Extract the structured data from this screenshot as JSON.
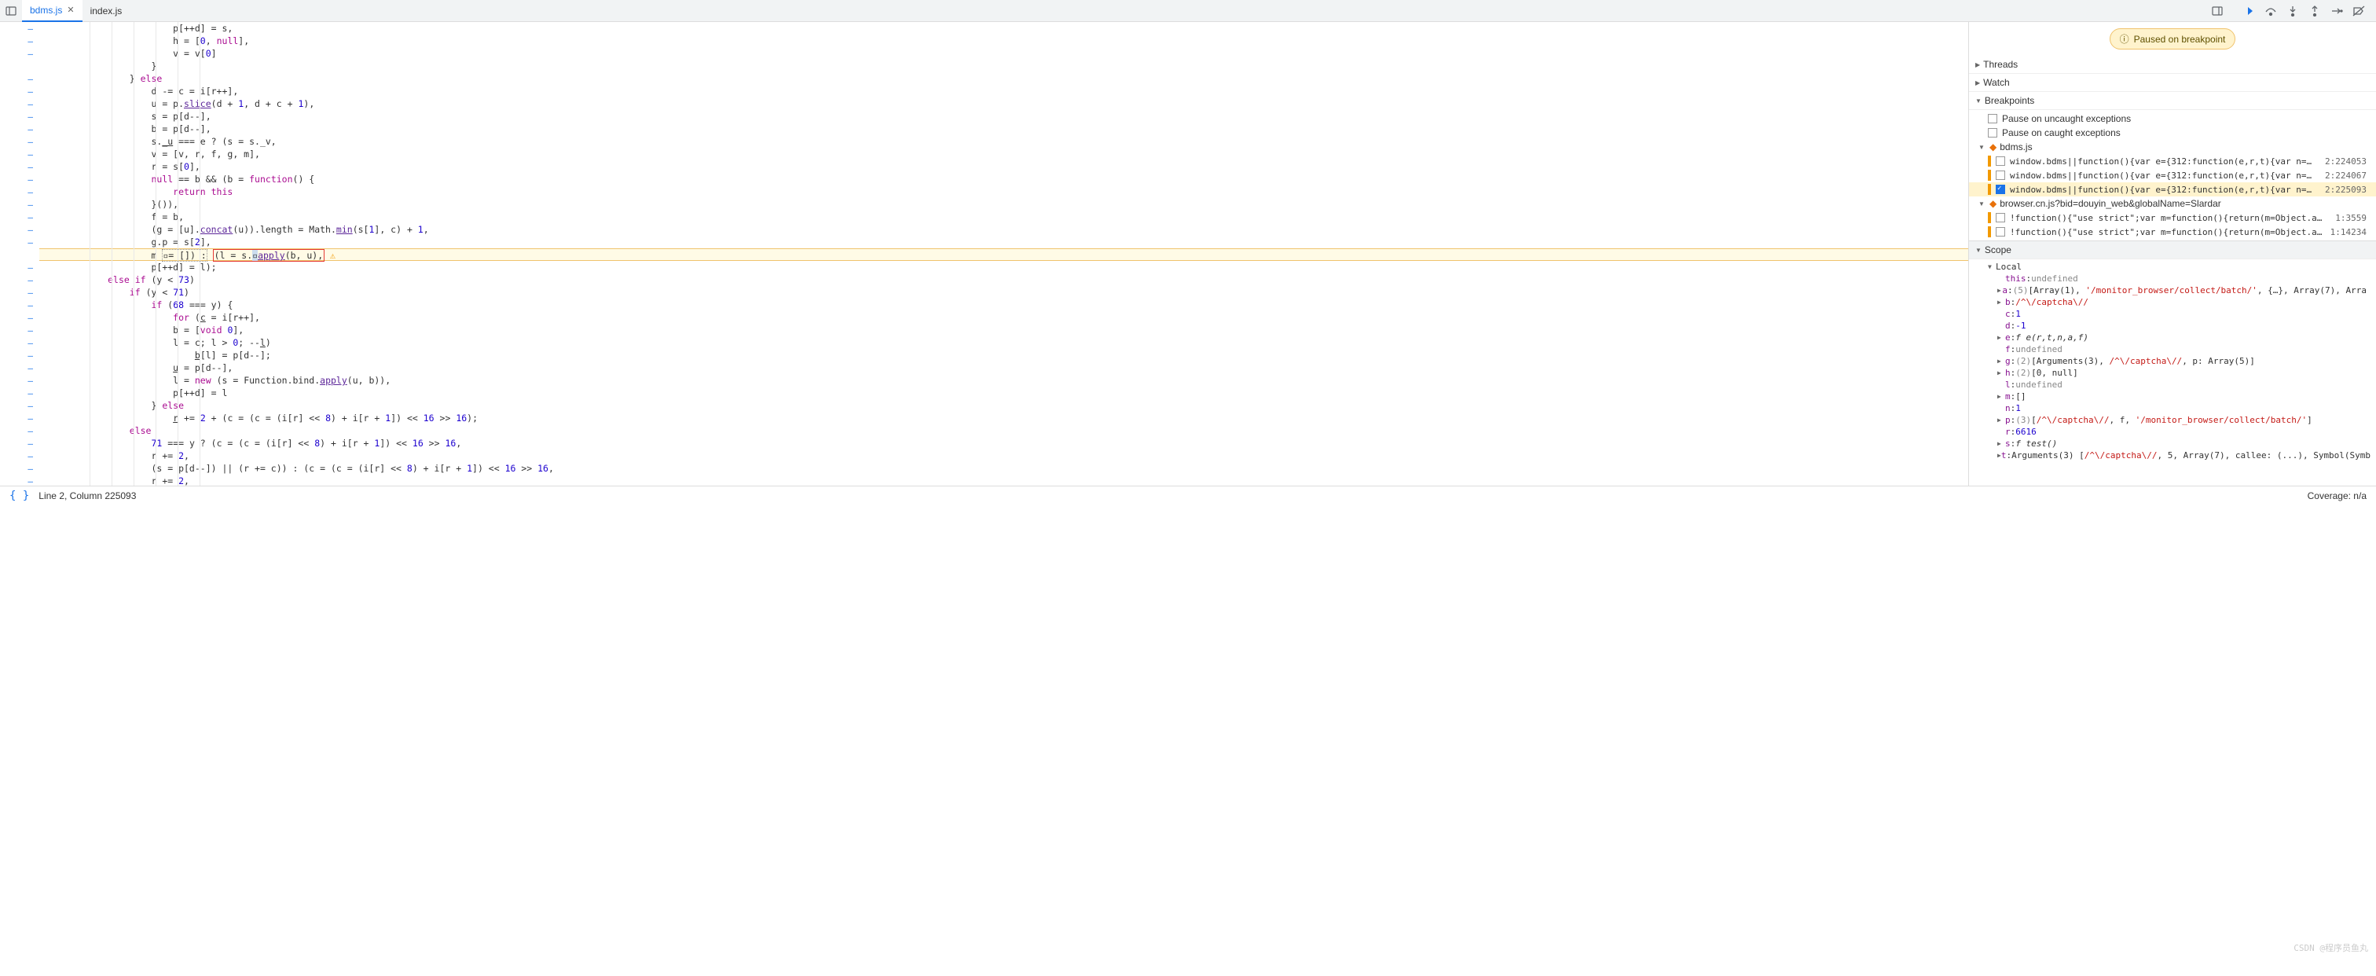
{
  "tabs": [
    {
      "name": "bdms.js",
      "active": true
    },
    {
      "name": "index.js",
      "active": false
    }
  ],
  "paused_text": "Paused on breakpoint",
  "panels": {
    "threads": "Threads",
    "watch": "Watch",
    "breakpoints": "Breakpoints",
    "scope": "Scope"
  },
  "bp_options": {
    "uncaught": "Pause on uncaught exceptions",
    "caught": "Pause on caught exceptions"
  },
  "bp_groups": [
    {
      "file": "bdms.js",
      "items": [
        {
          "text": "window.bdms||function(){var e={312:function(e,r,t){var n=…",
          "loc": "2:224053",
          "checked": false,
          "active": false
        },
        {
          "text": "window.bdms||function(){var e={312:function(e,r,t){var n=…",
          "loc": "2:224067",
          "checked": false,
          "active": false
        },
        {
          "text": "window.bdms||function(){var e={312:function(e,r,t){var n=…",
          "loc": "2:225093",
          "checked": true,
          "active": true
        }
      ]
    },
    {
      "file": "browser.cn.js?bid=douyin_web&globalName=Slardar",
      "items": [
        {
          "text": "!function(){\"use strict\";var m=function(){return(m=Object.a…",
          "loc": "1:3559",
          "checked": false,
          "active": false
        },
        {
          "text": "!function(){\"use strict\";var m=function(){return(m=Object.a…",
          "loc": "1:14234",
          "checked": false,
          "active": false
        }
      ]
    }
  ],
  "scope": {
    "local": "Local",
    "this_val": "undefined",
    "vars": [
      {
        "name": "a",
        "prefix": "(5)",
        "val": "[Array(1), '/monitor_browser/collect/batch/', {…}, Array(7), Arra",
        "expand": true
      },
      {
        "name": "b",
        "val": "/^\\/captcha\\//",
        "expand": true,
        "regex": true
      },
      {
        "name": "c",
        "val": "1",
        "num": true
      },
      {
        "name": "d",
        "val": "-1",
        "num": true
      },
      {
        "name": "e",
        "val": "f e(r,t,n,a,f)",
        "expand": true,
        "fn": true
      },
      {
        "name": "f",
        "val": "undefined",
        "undef": true
      },
      {
        "name": "g",
        "prefix": "(2)",
        "val": "[Arguments(3), /^\\/captcha\\//, p: Array(5)]",
        "expand": true
      },
      {
        "name": "h",
        "prefix": "(2)",
        "val": "[0, null]",
        "expand": true
      },
      {
        "name": "l",
        "val": "undefined",
        "undef": true
      },
      {
        "name": "m",
        "val": "[]",
        "expand": true
      },
      {
        "name": "n",
        "val": "1",
        "num": true
      },
      {
        "name": "p",
        "prefix": "(3)",
        "val": "[/^\\/captcha\\//, f, '/monitor_browser/collect/batch/']",
        "expand": true
      },
      {
        "name": "r",
        "val": "6616",
        "num": true
      },
      {
        "name": "s",
        "val": "f test()",
        "expand": true,
        "fn": true
      },
      {
        "name": "t",
        "val": "Arguments(3) [/^\\/captcha\\//, 5, Array(7), callee: (...), Symbol(Symb",
        "expand": true
      }
    ]
  },
  "code_lines": [
    "                        p[++d] = s,",
    "                        h = [0, null],",
    "                        v = v[0]",
    "                    }",
    "                } else",
    "                    d -= c = i[r++],",
    "                    u = p.slice(d + 1, d + c + 1),",
    "                    s = p[d--],",
    "                    b = p[d--],",
    "                    s._u === e ? (s = s._v,",
    "                    v = [v, r, f, g, m],",
    "                    r = s[0],",
    "                    null == b && (b = function() {",
    "                        return this",
    "                    }()),",
    "                    f = b,",
    "                    (g = [u].concat(u)).length = Math.min(s[1], c) + 1,",
    "                    g.p = s[2],",
    "                    m  = []) :  (l = s. apply(b, u),  ",
    "                    p[++d] = l);",
    "            else if (y < 73)",
    "                if (y < 71)",
    "                    if (68 === y) {",
    "                        for (c = i[r++],",
    "                        b = [void 0],",
    "                        l = c; l > 0; --l)",
    "                            b[l] = p[d--];",
    "                        u = p[d--],",
    "                        l = new (s = Function.bind.apply(u, b)),",
    "                        p[++d] = l",
    "                    } else",
    "                        r += 2 + (c = (c = (i[r] << 8) + i[r + 1]) << 16 >> 16);",
    "                else",
    "                    71 === y ? (c = (c = (i[r] << 8) + i[r + 1]) << 16 >> 16,",
    "                    r += 2,",
    "                    (s = p[d--]) || (r += c)) : (c = (c = (i[r] << 8) + i[r + 1]) << 16 >> 16,",
    "                    r += 2,"
  ],
  "status": {
    "cursor": "Line 2, Column 225093",
    "coverage": "Coverage: n/a"
  },
  "watermark": "CSDN @程序员鱼丸"
}
